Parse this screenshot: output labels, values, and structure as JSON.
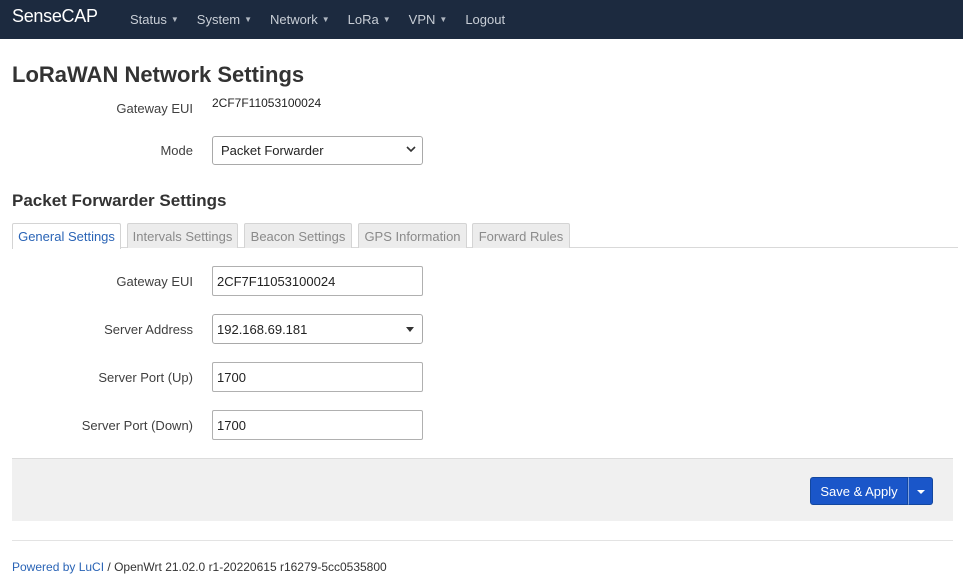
{
  "navbar": {
    "brand": "SenseCAP",
    "items": [
      {
        "label": "Status",
        "has_menu": true
      },
      {
        "label": "System",
        "has_menu": true
      },
      {
        "label": "Network",
        "has_menu": true
      },
      {
        "label": "LoRa",
        "has_menu": true
      },
      {
        "label": "VPN",
        "has_menu": true
      },
      {
        "label": "Logout",
        "has_menu": false
      }
    ]
  },
  "page": {
    "title": "LoRaWAN Network Settings",
    "gateway_eui_label": "Gateway EUI",
    "gateway_eui_value": "2CF7F11053100024",
    "mode_label": "Mode",
    "mode_value": "Packet Forwarder"
  },
  "packet_forwarder": {
    "title": "Packet Forwarder Settings",
    "tabs": [
      {
        "label": "General Settings",
        "active": true
      },
      {
        "label": "Intervals Settings",
        "active": false
      },
      {
        "label": "Beacon Settings",
        "active": false
      },
      {
        "label": "GPS Information",
        "active": false
      },
      {
        "label": "Forward Rules",
        "active": false
      }
    ],
    "fields": {
      "gateway_eui_label": "Gateway EUI",
      "gateway_eui_value": "2CF7F11053100024",
      "server_address_label": "Server Address",
      "server_address_value": "192.168.69.181",
      "port_up_label": "Server Port (Up)",
      "port_up_value": "1700",
      "port_down_label": "Server Port (Down)",
      "port_down_value": "1700"
    }
  },
  "actions": {
    "save_apply_label": "Save & Apply"
  },
  "footer": {
    "link_text": "Powered by LuCI",
    "version_text": " / OpenWrt 21.02.0 r1-20220615 r16279-5cc0535800"
  },
  "colors": {
    "navbar_bg": "#1c2a3f",
    "accent_blue": "#1a56c9",
    "link_blue": "#2a64b6"
  }
}
